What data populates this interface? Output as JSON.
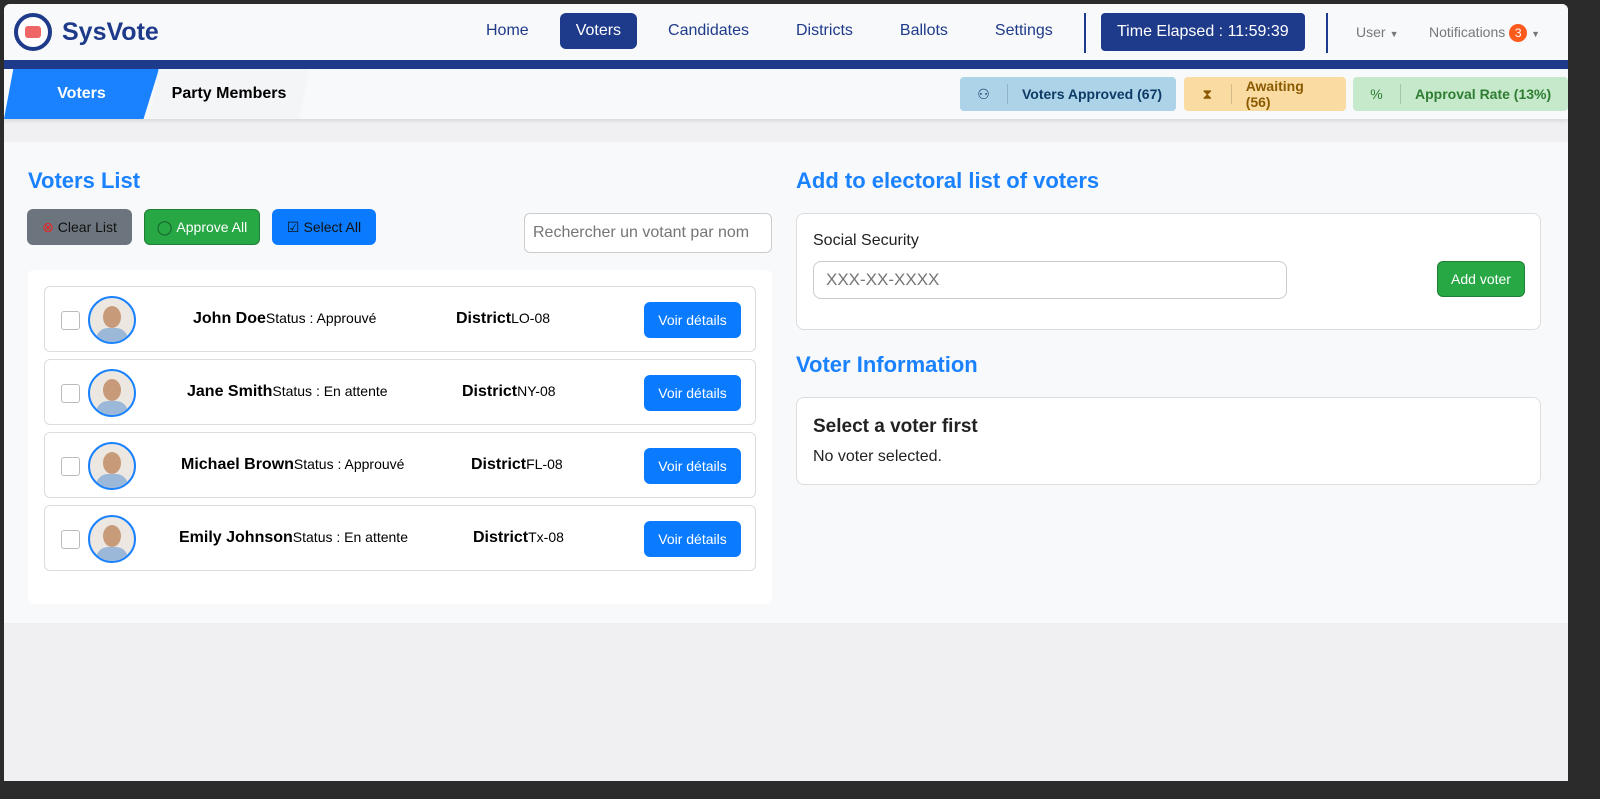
{
  "brand": "SysVote",
  "nav": {
    "links": [
      "Home",
      "Voters",
      "Candidates",
      "Districts",
      "Ballots",
      "Settings"
    ],
    "active": 1,
    "timer": "Time Elapsed : 11:59:39",
    "user": "User",
    "notifications": "Notifications",
    "notif_count": "3"
  },
  "tabs": [
    "Voters",
    "Party Members"
  ],
  "stats": [
    {
      "icon": "user-check-icon",
      "glyph": "⚇",
      "label": "Voters Approved (67)",
      "bg": "#acd3e8",
      "color": "#0d3b66"
    },
    {
      "icon": "hourglass-icon",
      "glyph": "⧗",
      "label": "Awaiting (56)",
      "bg": "#fadca3",
      "color": "#8a5a00"
    },
    {
      "icon": "percent-icon",
      "glyph": "%",
      "label": "Approval Rate (13%)",
      "bg": "#c6e8cb",
      "color": "#2e7d32"
    }
  ],
  "voters_list": {
    "title": "Voters List",
    "clear": "Clear List",
    "approve": "Approve All",
    "select": "Select All",
    "search_placeholder": "Rechercher un votant par nom",
    "voters": [
      {
        "name": "John Doe",
        "status": "Status : Approuvé",
        "district_label": "District",
        "district": "LO-08",
        "button": "Voir détails"
      },
      {
        "name": "Jane Smith",
        "status": "Status : En attente",
        "district_label": "District",
        "district": "NY-08",
        "button": "Voir détails"
      },
      {
        "name": "Michael Brown",
        "status": "Status : Approuvé",
        "district_label": "District",
        "district": "FL-08",
        "button": "Voir détails"
      },
      {
        "name": "Emily Johnson",
        "status": "Status : En attente",
        "district_label": "District",
        "district": "Tx-08",
        "button": "Voir détails"
      }
    ]
  },
  "add": {
    "title": "Add to electoral list of voters",
    "label": "Social Security",
    "placeholder": "XXX-XX-XXXX",
    "button": "Add voter"
  },
  "info": {
    "title": "Voter Information",
    "heading": "Select a voter first",
    "text": "No voter selected."
  }
}
